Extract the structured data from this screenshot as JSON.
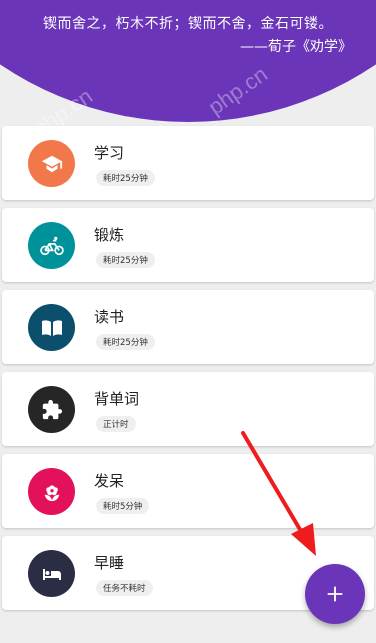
{
  "header": {
    "quote": "锲而舍之，朽木不折；锲而不舍，金石可镂。",
    "attribution": "——荀子《劝学》"
  },
  "tasks": [
    {
      "title": "学习",
      "badge": "耗时25分钟",
      "icon": "graduation-cap-icon",
      "color": "#f2784b"
    },
    {
      "title": "锻炼",
      "badge": "耗时25分钟",
      "icon": "bicycle-icon",
      "color": "#00929a"
    },
    {
      "title": "读书",
      "badge": "耗时25分钟",
      "icon": "book-icon",
      "color": "#0b4f6c"
    },
    {
      "title": "背单词",
      "badge": "正计时",
      "icon": "puzzle-icon",
      "color": "#262626"
    },
    {
      "title": "发呆",
      "badge": "耗时5分钟",
      "icon": "flower-icon",
      "color": "#e3115b"
    },
    {
      "title": "早睡",
      "badge": "任务不耗时",
      "icon": "bed-icon",
      "color": "#2b2d45"
    }
  ],
  "fab": {
    "label": "+",
    "icon": "plus-icon",
    "color": "#6a35b8"
  },
  "annotation": {
    "arrow_color": "#ee1c1c"
  },
  "watermark": "php.cn"
}
